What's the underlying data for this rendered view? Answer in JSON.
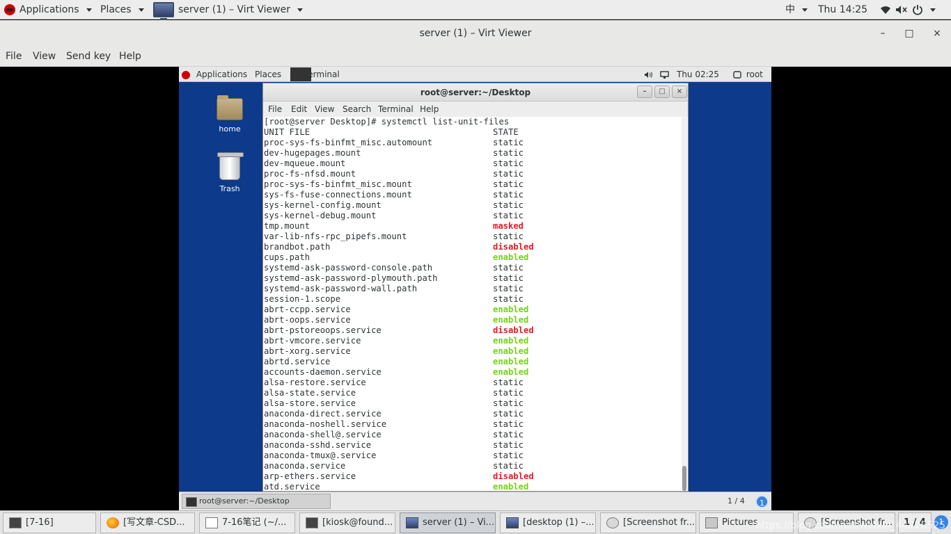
{
  "host_topbar": {
    "applications": "Applications",
    "places": "Places",
    "window_menu": "server (1) – Virt Viewer",
    "input_method": "中",
    "clock": "Thu 14:25"
  },
  "virt_viewer": {
    "title": "server (1) – Virt Viewer",
    "minimize": "–",
    "maximize": "□",
    "close": "×",
    "menu": [
      "File",
      "View",
      "Send key",
      "Help"
    ]
  },
  "guest": {
    "topbar": {
      "applications": "Applications",
      "places": "Places",
      "terminal": "Terminal",
      "clock": "Thu 02:25",
      "user": "root"
    },
    "desktop_icons": {
      "home": "home",
      "trash": "Trash"
    },
    "terminal": {
      "title": "root@server:~/Desktop",
      "menu": [
        "File",
        "Edit",
        "View",
        "Search",
        "Terminal",
        "Help"
      ],
      "prompt": "[root@server Desktop]# systemctl list-unit-files",
      "header": {
        "unit": "UNIT FILE",
        "state": "STATE"
      },
      "rows": [
        {
          "unit": "proc-sys-fs-binfmt_misc.automount",
          "state": "static"
        },
        {
          "unit": "dev-hugepages.mount",
          "state": "static"
        },
        {
          "unit": "dev-mqueue.mount",
          "state": "static"
        },
        {
          "unit": "proc-fs-nfsd.mount",
          "state": "static"
        },
        {
          "unit": "proc-sys-fs-binfmt_misc.mount",
          "state": "static"
        },
        {
          "unit": "sys-fs-fuse-connections.mount",
          "state": "static"
        },
        {
          "unit": "sys-kernel-config.mount",
          "state": "static"
        },
        {
          "unit": "sys-kernel-debug.mount",
          "state": "static"
        },
        {
          "unit": "tmp.mount",
          "state": "masked"
        },
        {
          "unit": "var-lib-nfs-rpc_pipefs.mount",
          "state": "static"
        },
        {
          "unit": "brandbot.path",
          "state": "disabled"
        },
        {
          "unit": "cups.path",
          "state": "enabled"
        },
        {
          "unit": "systemd-ask-password-console.path",
          "state": "static"
        },
        {
          "unit": "systemd-ask-password-plymouth.path",
          "state": "static"
        },
        {
          "unit": "systemd-ask-password-wall.path",
          "state": "static"
        },
        {
          "unit": "session-1.scope",
          "state": "static"
        },
        {
          "unit": "abrt-ccpp.service",
          "state": "enabled"
        },
        {
          "unit": "abrt-oops.service",
          "state": "enabled"
        },
        {
          "unit": "abrt-pstoreoops.service",
          "state": "disabled"
        },
        {
          "unit": "abrt-vmcore.service",
          "state": "enabled"
        },
        {
          "unit": "abrt-xorg.service",
          "state": "enabled"
        },
        {
          "unit": "abrtd.service",
          "state": "enabled"
        },
        {
          "unit": "accounts-daemon.service",
          "state": "enabled"
        },
        {
          "unit": "alsa-restore.service",
          "state": "static"
        },
        {
          "unit": "alsa-state.service",
          "state": "static"
        },
        {
          "unit": "alsa-store.service",
          "state": "static"
        },
        {
          "unit": "anaconda-direct.service",
          "state": "static"
        },
        {
          "unit": "anaconda-noshell.service",
          "state": "static"
        },
        {
          "unit": "anaconda-shell@.service",
          "state": "static"
        },
        {
          "unit": "anaconda-sshd.service",
          "state": "static"
        },
        {
          "unit": "anaconda-tmux@.service",
          "state": "static"
        },
        {
          "unit": "anaconda.service",
          "state": "static"
        },
        {
          "unit": "arp-ethers.service",
          "state": "disabled"
        },
        {
          "unit": "atd.service",
          "state": "enabled"
        }
      ]
    },
    "bottom_bar": {
      "task": "root@server:~/Desktop",
      "workspace": "1 / 4",
      "workspace_badge": "1"
    }
  },
  "host_taskbar": {
    "tasks": [
      {
        "label": "[7-16]",
        "icon": "terminal-icon"
      },
      {
        "label": "[写文章-CSD...",
        "icon": "firefox-icon"
      },
      {
        "label": "7-16笔记 (~/...",
        "icon": "notepad-icon"
      },
      {
        "label": "[kiosk@found...",
        "icon": "terminal-icon"
      },
      {
        "label": "server (1) – Vi...",
        "icon": "monitor-icon"
      },
      {
        "label": "[desktop (1) –...",
        "icon": "monitor-icon"
      },
      {
        "label": "[Screenshot fr...",
        "icon": "screenshot-icon"
      },
      {
        "label": "Pictures",
        "icon": "folder-icon"
      },
      {
        "label": "[Screenshot fr...",
        "icon": "screenshot-icon"
      }
    ],
    "pager": "1 / 4",
    "badge": "1"
  },
  "watermark": "https://blog.csdn.net/weixin_44226525"
}
